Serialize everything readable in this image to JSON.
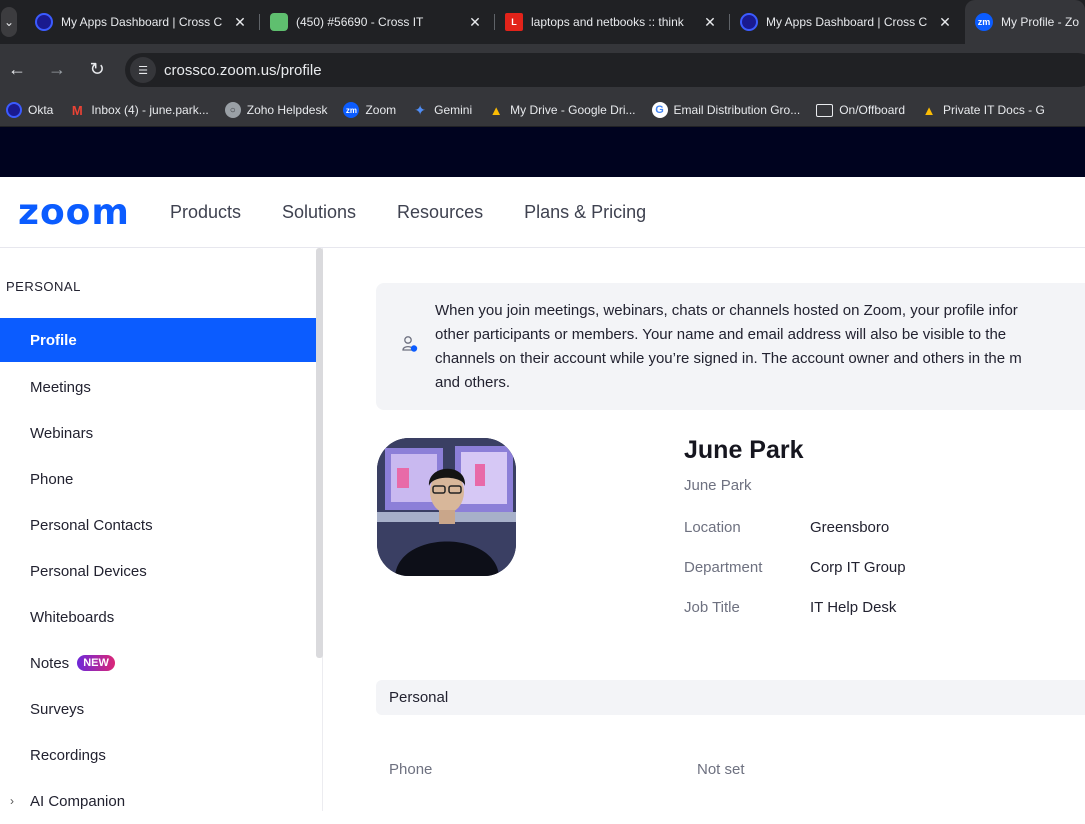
{
  "browser": {
    "tabs": [
      {
        "title": "My Apps Dashboard | Cross C",
        "icon": "okta-icon"
      },
      {
        "title": "(450) #56690 - Cross IT",
        "icon": "zoho-desk-icon"
      },
      {
        "title": "laptops and netbooks :: think",
        "icon": "lenovo-icon"
      },
      {
        "title": "My Apps Dashboard | Cross C",
        "icon": "okta-icon"
      },
      {
        "title": "My Profile - Zo",
        "icon": "zoom-icon"
      }
    ],
    "url": "crossco.zoom.us/profile",
    "bookmarks": [
      {
        "label": "Okta"
      },
      {
        "label": "Inbox (4) - june.park..."
      },
      {
        "label": "Zoho Helpdesk"
      },
      {
        "label": "Zoom"
      },
      {
        "label": "Gemini"
      },
      {
        "label": "My Drive - Google Dri..."
      },
      {
        "label": "Email Distribution Gro..."
      },
      {
        "label": "On/Offboard"
      },
      {
        "label": "Private IT Docs - G"
      }
    ]
  },
  "header": {
    "logo": "zoom",
    "nav": [
      "Products",
      "Solutions",
      "Resources",
      "Plans & Pricing"
    ]
  },
  "sidebar": {
    "section": "PERSONAL",
    "items": [
      {
        "label": "Profile"
      },
      {
        "label": "Meetings"
      },
      {
        "label": "Webinars"
      },
      {
        "label": "Phone"
      },
      {
        "label": "Personal Contacts"
      },
      {
        "label": "Personal Devices"
      },
      {
        "label": "Whiteboards"
      },
      {
        "label": "Notes",
        "badge": "NEW"
      },
      {
        "label": "Surveys"
      },
      {
        "label": "Recordings"
      },
      {
        "label": "AI Companion"
      }
    ]
  },
  "main": {
    "notice": "When you join meetings, webinars, chats or channels hosted on Zoom, your profile infor\nother participants or members. Your name and email address will also be visible to the\nchannels on their account while you’re signed in. The account owner and others in the m\nand others.",
    "profile": {
      "name": "June Park",
      "subtitle": "June Park",
      "location_label": "Location",
      "location": "Greensboro",
      "department_label": "Department",
      "department": "Corp IT Group",
      "job_title_label": "Job Title",
      "job_title": "IT Help Desk"
    },
    "section_personal": "Personal",
    "phone_label": "Phone",
    "phone_value": "Not set"
  },
  "colors": {
    "zoom_blue": "#0b5cff",
    "chrome_dark": "#202124",
    "chrome_mid": "#35363a"
  }
}
